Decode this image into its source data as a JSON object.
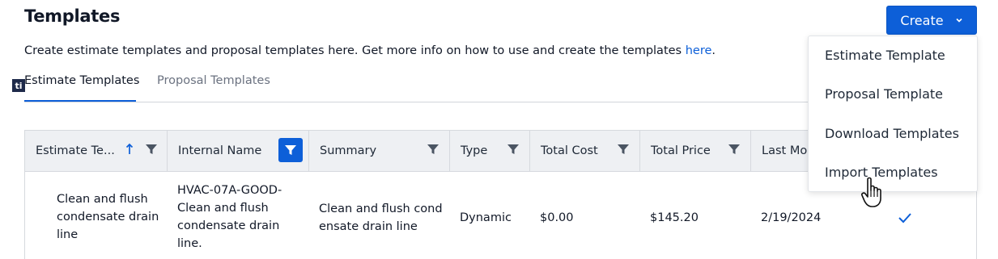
{
  "page": {
    "title": "Templates",
    "description_text": "Create estimate templates and proposal templates here. Get more info on how to use and create the templates ",
    "description_link": "here",
    "description_end": "."
  },
  "create_button": {
    "label": "Create",
    "icon": "chevron-down-icon"
  },
  "tabs": [
    {
      "label": "Estimate Templates",
      "active": true
    },
    {
      "label": "Proposal Templates",
      "active": false
    }
  ],
  "table": {
    "columns": [
      {
        "label": "Estimate Te...",
        "sorted": "ascending",
        "filter_active": false
      },
      {
        "label": "Internal Name",
        "filter_active": true
      },
      {
        "label": "Summary",
        "filter_active": false
      },
      {
        "label": "Type",
        "filter_active": false
      },
      {
        "label": "Total Cost",
        "filter_active": false
      },
      {
        "label": "Total Price",
        "filter_active": false
      },
      {
        "label": "Last Mod"
      }
    ],
    "rows": [
      {
        "logo": "ti",
        "name_lines": [
          "Clean and flush",
          "condensate drain",
          "line"
        ],
        "internal_name_lines": [
          "HVAC-07A-GOOD-",
          "Clean and flush",
          "condensate drain",
          "line."
        ],
        "summary_lines": [
          "Clean and flush cond",
          "ensate drain line"
        ],
        "type": "Dynamic",
        "total_cost": "$0.00",
        "total_price": "$145.20",
        "last_modified": "2/19/2024",
        "checked": true
      }
    ]
  },
  "create_menu": {
    "items": [
      "Estimate Template",
      "Proposal Template",
      "Download Templates",
      "Import Templates"
    ]
  },
  "colors": {
    "accent": "#0d5fd8",
    "header_bg": "#eef0f3",
    "logo_bg": "#1e2a4a"
  }
}
